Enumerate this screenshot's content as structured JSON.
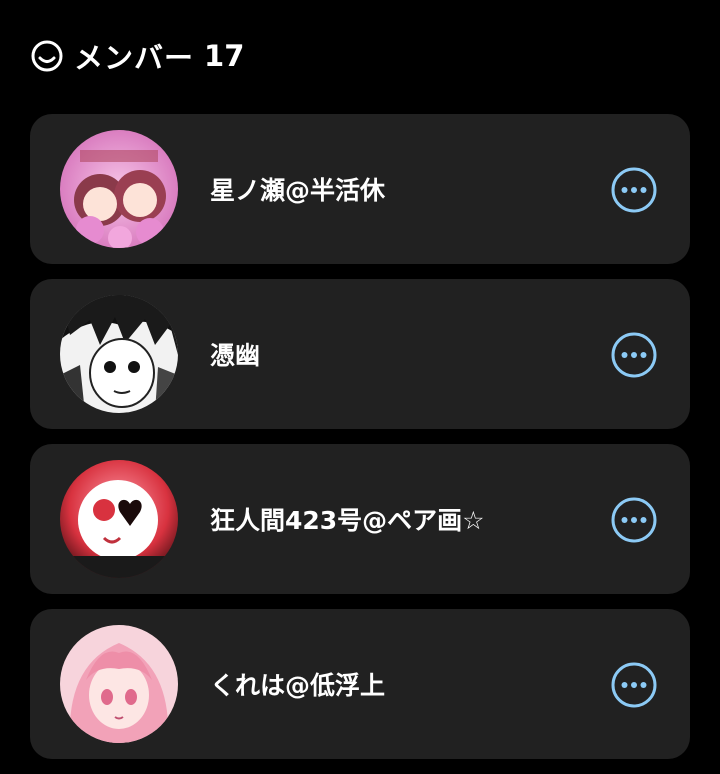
{
  "header": {
    "icon": "smile-icon",
    "title": "メンバー",
    "count": "17"
  },
  "colors": {
    "background": "#000000",
    "card": "#212121",
    "accent": "#8ccaf5",
    "text": "#ffffff"
  },
  "members": [
    {
      "name": "星ノ瀬@半活休",
      "avatar": "pink-twins-avatar",
      "more_icon": "more-options-icon"
    },
    {
      "name": "憑幽",
      "avatar": "monochrome-manga-avatar",
      "more_icon": "more-options-icon"
    },
    {
      "name": "狂人間423号@ペア画☆",
      "avatar": "pink-heart-mask-avatar",
      "more_icon": "more-options-icon"
    },
    {
      "name": "くれは@低浮上",
      "avatar": "pink-hair-girl-avatar",
      "more_icon": "more-options-icon"
    }
  ]
}
